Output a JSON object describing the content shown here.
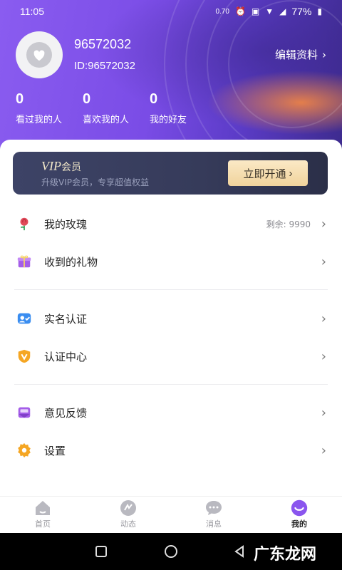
{
  "status": {
    "time": "11:05",
    "net_speed": "0.70",
    "battery": "77%"
  },
  "profile": {
    "name": "96572032",
    "id_text": "ID:96572032",
    "edit_label": "编辑资料"
  },
  "stats": [
    {
      "value": "0",
      "label": "看过我的人"
    },
    {
      "value": "0",
      "label": "喜欢我的人"
    },
    {
      "value": "0",
      "label": "我的好友"
    }
  ],
  "vip": {
    "title": "VIP",
    "title_suffix": "会员",
    "subtitle": "升级VIP会员，专享超值权益",
    "button_label": "立即开通"
  },
  "menu": {
    "roses": {
      "label": "我的玫瑰",
      "value": "剩余: 9990",
      "icon": "rose-icon"
    },
    "gifts": {
      "label": "收到的礼物",
      "icon": "gift-icon"
    },
    "real_name": {
      "label": "实名认证",
      "icon": "id-card-icon"
    },
    "verify_center": {
      "label": "认证中心",
      "icon": "shield-v-icon"
    },
    "feedback": {
      "label": "意见反馈",
      "icon": "mail-icon"
    },
    "settings": {
      "label": "设置",
      "icon": "gear-icon"
    }
  },
  "tabs": [
    {
      "label": "首页",
      "icon": "home-icon"
    },
    {
      "label": "动态",
      "icon": "feed-icon"
    },
    {
      "label": "消息",
      "icon": "chat-icon"
    },
    {
      "label": "我的",
      "icon": "smile-icon"
    }
  ],
  "watermark": "广东龙网",
  "colors": {
    "accent": "#7a4ce6",
    "vip_gold": "#f0d39c",
    "orange_icon": "#f5a623",
    "blue_icon": "#3a8df0"
  }
}
